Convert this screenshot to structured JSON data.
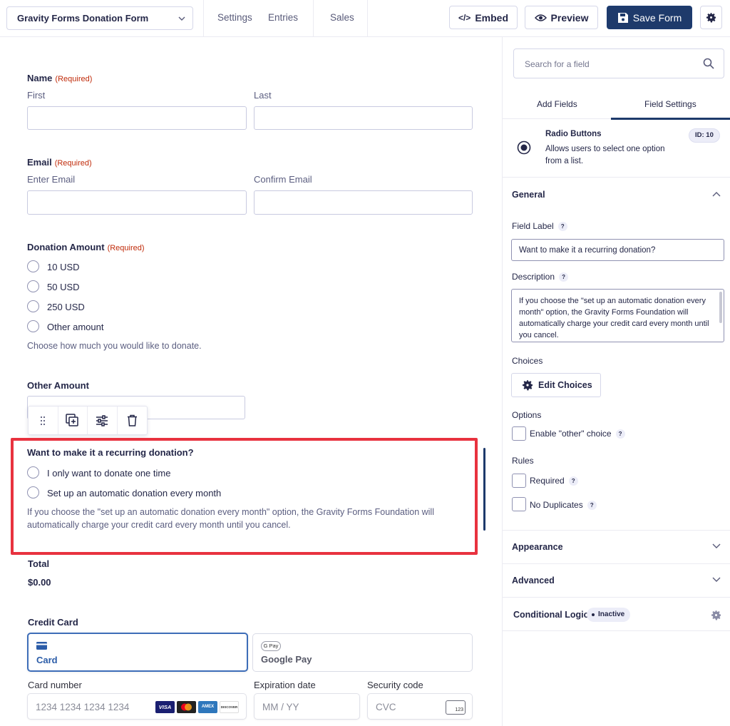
{
  "topbar": {
    "form_title": "Gravity Forms Donation Form",
    "nav": [
      "Settings",
      "Entries",
      "Sales"
    ],
    "embed_label": "Embed",
    "preview_label": "Preview",
    "save_label": "Save Form"
  },
  "form": {
    "name": {
      "label": "Name",
      "required": "(Required)",
      "first": "First",
      "last": "Last"
    },
    "email": {
      "label": "Email",
      "required": "(Required)",
      "enter": "Enter Email",
      "confirm": "Confirm Email"
    },
    "donation": {
      "label": "Donation Amount",
      "required": "(Required)",
      "options": [
        "10 USD",
        "50 USD",
        "250 USD",
        "Other amount"
      ],
      "description": "Choose how much you would like to donate."
    },
    "other_amount": {
      "label": "Other Amount"
    },
    "recurring": {
      "label": "Want to make it a recurring donation?",
      "options": [
        "I only want to donate one time",
        "Set up an automatic donation every month"
      ],
      "description": "If you choose the \"set up an automatic donation every month\" option, the Gravity Forms Foundation will automatically charge your credit card every month until you cancel."
    },
    "total": {
      "label": "Total",
      "value": "$0.00"
    },
    "credit_card": {
      "label": "Credit Card",
      "card_tab": "Card",
      "gpay_badge": "G Pay",
      "gpay_tab": "Google Pay",
      "card_number_label": "Card number",
      "card_number_placeholder": "1234 1234 1234 1234",
      "expiration_label": "Expiration date",
      "expiration_placeholder": "MM / YY",
      "security_label": "Security code",
      "security_placeholder": "CVC",
      "cvc_icon_text": "123",
      "brands": [
        "VISA",
        "AMEX",
        "DISCOVER"
      ]
    }
  },
  "sidebar": {
    "search_placeholder": "Search for a field",
    "tabs": [
      "Add Fields",
      "Field Settings"
    ],
    "field_type": {
      "title": "Radio Buttons",
      "description": "Allows users to select one option from a list.",
      "id_badge": "ID: 10"
    },
    "general": "General",
    "field_label_title": "Field Label",
    "field_label_value": "Want to make it a recurring donation?",
    "description_title": "Description",
    "description_value": "If you choose the \"set up an automatic donation every month\" option, the Gravity Forms Foundation will automatically charge your credit card every month until you cancel.",
    "choices_title": "Choices",
    "edit_choices": "Edit Choices",
    "options_title": "Options",
    "enable_other": "Enable \"other\" choice",
    "rules_title": "Rules",
    "required": "Required",
    "no_duplicates": "No Duplicates",
    "appearance": "Appearance",
    "advanced": "Advanced",
    "conditional_logic": "Conditional Logic",
    "inactive": "Inactive"
  },
  "colors": {
    "accent": "#1e3a6b",
    "highlight": "#e8323f",
    "required": "#c02b0a",
    "link": "#204ce5"
  }
}
